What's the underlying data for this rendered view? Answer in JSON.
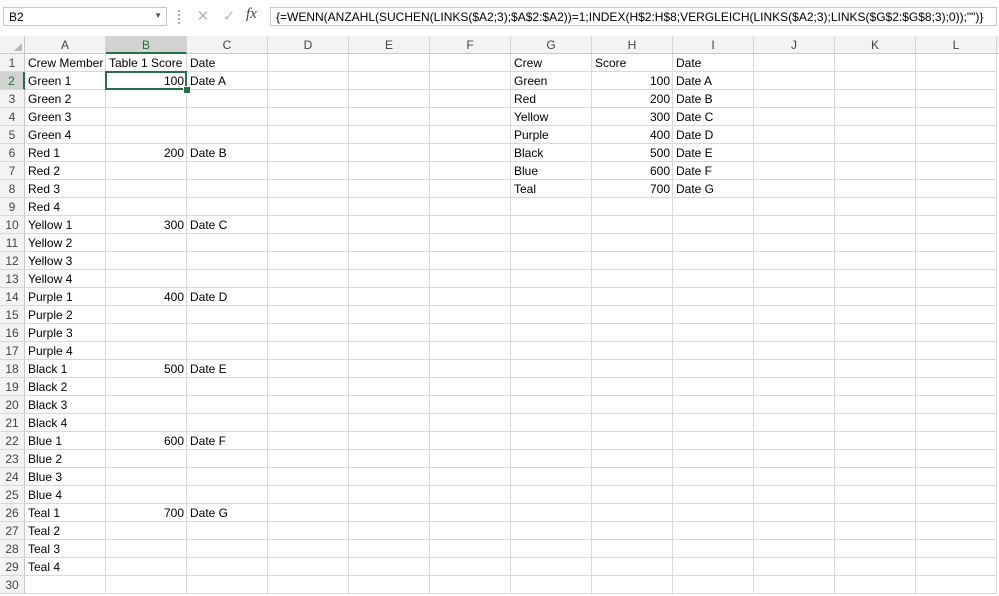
{
  "formula_bar": {
    "name_box": "B2",
    "fx": "fx",
    "formula": "{=WENN(ANZAHL(SUCHEN(LINKS($A2;3);$A$2:$A2))=1;INDEX(H$2:H$8;VERGLEICH(LINKS($A2;3);LINKS($G$2:$G$8;3);0));\"\")}"
  },
  "columns": [
    "A",
    "B",
    "C",
    "D",
    "E",
    "F",
    "G",
    "H",
    "I",
    "J",
    "K",
    "L"
  ],
  "rows": [
    "1",
    "2",
    "3",
    "4",
    "5",
    "6",
    "7",
    "8",
    "9",
    "10",
    "11",
    "12",
    "13",
    "14",
    "15",
    "16",
    "17",
    "18",
    "19",
    "20",
    "21",
    "22",
    "23",
    "24",
    "25",
    "26",
    "27",
    "28",
    "29",
    "30"
  ],
  "table1": {
    "headers": [
      "Crew Member",
      "Table 1 Score",
      "Date"
    ],
    "rows": [
      [
        "Green 1",
        "100",
        "Date A"
      ],
      [
        "Green 2",
        "",
        ""
      ],
      [
        "Green 3",
        "",
        ""
      ],
      [
        "Green 4",
        "",
        ""
      ],
      [
        "Red 1",
        "200",
        "Date B"
      ],
      [
        "Red 2",
        "",
        ""
      ],
      [
        "Red 3",
        "",
        ""
      ],
      [
        "Red 4",
        "",
        ""
      ],
      [
        "Yellow 1",
        "300",
        "Date C"
      ],
      [
        "Yellow 2",
        "",
        ""
      ],
      [
        "Yellow 3",
        "",
        ""
      ],
      [
        "Yellow 4",
        "",
        ""
      ],
      [
        "Purple 1",
        "400",
        "Date D"
      ],
      [
        "Purple 2",
        "",
        ""
      ],
      [
        "Purple 3",
        "",
        ""
      ],
      [
        "Purple 4",
        "",
        ""
      ],
      [
        "Black 1",
        "500",
        "Date E"
      ],
      [
        "Black 2",
        "",
        ""
      ],
      [
        "Black 3",
        "",
        ""
      ],
      [
        "Black 4",
        "",
        ""
      ],
      [
        "Blue 1",
        "600",
        "Date F"
      ],
      [
        "Blue 2",
        "",
        ""
      ],
      [
        "Blue 3",
        "",
        ""
      ],
      [
        "Blue 4",
        "",
        ""
      ],
      [
        "Teal 1",
        "700",
        "Date G"
      ],
      [
        "Teal 2",
        "",
        ""
      ],
      [
        "Teal 3",
        "",
        ""
      ],
      [
        "Teal 4",
        "",
        ""
      ]
    ]
  },
  "table2": {
    "headers": [
      "Crew",
      "Score",
      "Date"
    ],
    "rows": [
      [
        "Green",
        "100",
        "Date A"
      ],
      [
        "Red",
        "200",
        "Date B"
      ],
      [
        "Yellow",
        "300",
        "Date C"
      ],
      [
        "Purple",
        "400",
        "Date D"
      ],
      [
        "Black",
        "500",
        "Date E"
      ],
      [
        "Blue",
        "600",
        "Date F"
      ],
      [
        "Teal",
        "700",
        "Date G"
      ]
    ]
  },
  "colors": {
    "accent": "#217346",
    "grid": "#d9d9d9",
    "header_bg": "#f3f3f3"
  },
  "icons": [
    "cancel-icon",
    "enter-icon",
    "function-icon",
    "dropdown-icon"
  ]
}
